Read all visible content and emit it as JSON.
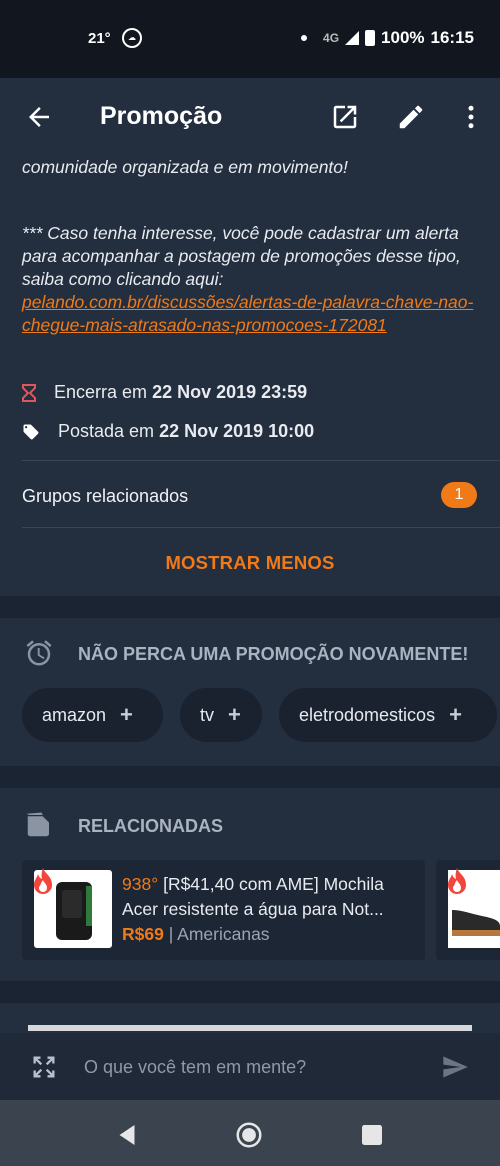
{
  "status_bar": {
    "temperature": "21°",
    "network": "4G",
    "battery": "100%",
    "time": "16:15"
  },
  "app_bar": {
    "title": "Promoção"
  },
  "description": {
    "line1": "comunidade organizada e em movimento!",
    "alert_text": "*** Caso tenha interesse, você pode cadastrar um alerta para acompanhar a postagem de promoções desse tipo, saiba como clicando aqui:",
    "alert_link": "pelando.com.br/discussões/alertas-de-palavra-chave-nao-chegue-mais-atrasado-nas-promocoes-172081"
  },
  "meta": {
    "ends_label": "Encerra em",
    "ends_value": "22 Nov 2019 23:59",
    "posted_label": "Postada em",
    "posted_value": "22 Nov 2019 10:00"
  },
  "groups": {
    "label": "Grupos relacionados",
    "count": "1"
  },
  "show_less": "MOSTRAR MENOS",
  "alerts": {
    "heading": "NÃO PERCA UMA PROMOÇÃO NOVAMENTE!",
    "chips": [
      {
        "label": "amazon"
      },
      {
        "label": "tv"
      },
      {
        "label": "eletrodomesticos"
      }
    ]
  },
  "related": {
    "heading": "RELACIONADAS",
    "deal": {
      "temperature": "938°",
      "title": "[R$41,40 com AME] Mochila Acer resistente a água para Not...",
      "price": "R$69",
      "store": "Americanas"
    }
  },
  "comment": {
    "placeholder": "O que você tem em mente?"
  },
  "colors": {
    "accent": "#f07a18",
    "background": "#1b2432",
    "card": "#232e3e"
  }
}
